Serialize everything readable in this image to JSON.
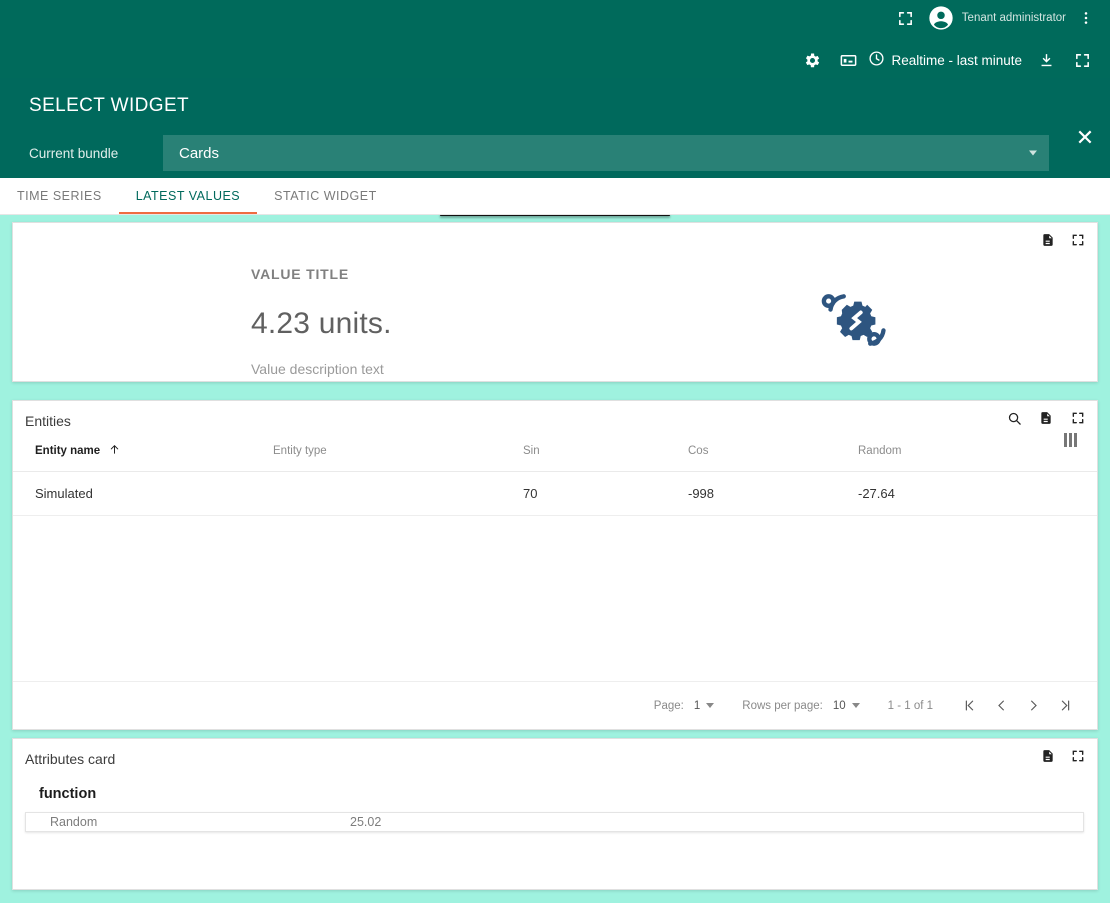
{
  "theme": {
    "primary": "#006a5b",
    "dialog_header": "#00695c",
    "accent_underline": "#ef6c42",
    "canvas_background": "#9ff2df",
    "illustration": "#2e5580"
  },
  "topbar": {
    "user_name": "Tenant administrator",
    "fullscreen_top_icon": "fullscreen-icon",
    "avatar_icon": "account-circle-icon",
    "more_icon": "more-vert-icon",
    "settings_icon": "gear-icon",
    "devices_icon": "dashboard-devices-icon",
    "clock_icon": "clock-icon",
    "timewindow_label": "Realtime - last minute",
    "download_icon": "download-icon",
    "fullscreen_icon": "fullscreen-icon"
  },
  "dialog": {
    "title": "SELECT WIDGET",
    "close_icon": "close-icon",
    "close_label": "✕",
    "bundle_label": "Current bundle",
    "bundle_value": "Cards",
    "bundle_options": [
      "Cards"
    ]
  },
  "tabs": [
    {
      "label": "TIME SERIES",
      "active": false
    },
    {
      "label": "LATEST VALUES",
      "active": true
    },
    {
      "label": "STATIC WIDGET",
      "active": false
    }
  ],
  "value_card": {
    "title": "VALUE TITLE",
    "value": "4.23 units.",
    "description": "Value description text",
    "export_icon": "export-document-icon",
    "fullscreen_icon": "fullscreen-icon",
    "illustration_icon": "gear-network-icon"
  },
  "entities_card": {
    "title": "Entities",
    "search_icon": "search-icon",
    "export_icon": "export-document-icon",
    "fullscreen_icon": "fullscreen-icon",
    "columns_icon": "column-toggle-icon",
    "sort_icon": "sort-ascending-arrow-icon",
    "columns": [
      "Entity name",
      "Entity type",
      "Sin",
      "Cos",
      "Random"
    ],
    "sorted_column": "Entity name",
    "sort_direction": "asc",
    "rows": [
      {
        "entity_name": "Simulated",
        "entity_type": "",
        "sin": "70",
        "cos": "-998",
        "random": "-27.64"
      }
    ],
    "paginator": {
      "page_label": "Page:",
      "page_value": "1",
      "rows_per_page_label": "Rows per page:",
      "rows_per_page_value": "10",
      "range_label": "1 - 1 of 1",
      "first_icon": "first-page-icon",
      "prev_icon": "previous-page-icon",
      "next_icon": "next-page-icon",
      "last_icon": "last-page-icon"
    }
  },
  "attributes_card": {
    "title": "Attributes card",
    "export_icon": "export-document-icon",
    "fullscreen_icon": "fullscreen-icon",
    "section_label": "function",
    "rows": [
      {
        "key": "Random",
        "value": "25.02"
      }
    ]
  }
}
